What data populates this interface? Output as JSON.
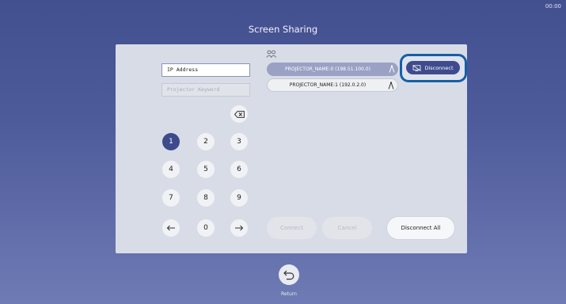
{
  "clock": "00:00",
  "title": "Screen Sharing",
  "fields": {
    "ip_label": "IP Address",
    "keyword_label": "Projector Keyword"
  },
  "keypad": {
    "keys": [
      "1",
      "2",
      "3",
      "4",
      "5",
      "6",
      "7",
      "8",
      "9",
      "0"
    ],
    "selected": "1",
    "icons": [
      "backspace-icon",
      "arrow-left-icon",
      "arrow-right-icon"
    ]
  },
  "projectors": [
    {
      "label": "PROJECTOR_NAME:0 (198.51.100.0)",
      "selected": true
    },
    {
      "label": "PROJECTOR_NAME:1 (192.0.2.0)",
      "selected": false
    }
  ],
  "buttons": {
    "disconnect": "Disconnect",
    "connect": "Connect",
    "cancel": "Cancel",
    "disconnect_all": "Disconnect All",
    "return": "Return"
  },
  "colors": {
    "accent": "#3d4b8c",
    "highlight_ring": "#1560a6"
  }
}
